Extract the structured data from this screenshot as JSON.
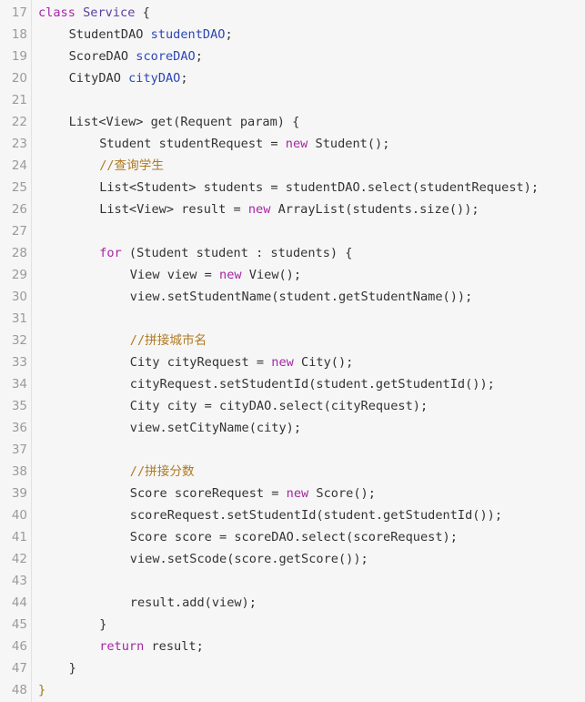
{
  "editor": {
    "language": "java",
    "lines": [
      {
        "n": "17",
        "indent": 0,
        "tokens": [
          {
            "t": "class",
            "k": "kw"
          },
          {
            "t": " ",
            "k": "plain"
          },
          {
            "t": "Service",
            "k": "cls"
          },
          {
            "t": " {",
            "k": "plain"
          }
        ]
      },
      {
        "n": "18",
        "indent": 1,
        "tokens": [
          {
            "t": "StudentDAO ",
            "k": "plain"
          },
          {
            "t": "studentDAO",
            "k": "field"
          },
          {
            "t": ";",
            "k": "plain"
          }
        ]
      },
      {
        "n": "19",
        "indent": 1,
        "tokens": [
          {
            "t": "ScoreDAO ",
            "k": "plain"
          },
          {
            "t": "scoreDAO",
            "k": "field"
          },
          {
            "t": ";",
            "k": "plain"
          }
        ]
      },
      {
        "n": "20",
        "indent": 1,
        "tokens": [
          {
            "t": "CityDAO ",
            "k": "plain"
          },
          {
            "t": "cityDAO",
            "k": "field"
          },
          {
            "t": ";",
            "k": "plain"
          }
        ]
      },
      {
        "n": "21",
        "indent": 0,
        "tokens": []
      },
      {
        "n": "22",
        "indent": 1,
        "tokens": [
          {
            "t": "List<View> get(Requent param) {",
            "k": "plain"
          }
        ]
      },
      {
        "n": "23",
        "indent": 2,
        "tokens": [
          {
            "t": "Student studentRequest = ",
            "k": "plain"
          },
          {
            "t": "new",
            "k": "kw"
          },
          {
            "t": " Student();",
            "k": "plain"
          }
        ]
      },
      {
        "n": "24",
        "indent": 2,
        "tokens": [
          {
            "t": "//查询学生",
            "k": "comment"
          }
        ]
      },
      {
        "n": "25",
        "indent": 2,
        "tokens": [
          {
            "t": "List<Student> students = studentDAO.select(studentRequest);",
            "k": "plain"
          }
        ]
      },
      {
        "n": "26",
        "indent": 2,
        "tokens": [
          {
            "t": "List<View> result = ",
            "k": "plain"
          },
          {
            "t": "new",
            "k": "kw"
          },
          {
            "t": " ArrayList(students.size());",
            "k": "plain"
          }
        ]
      },
      {
        "n": "27",
        "indent": 0,
        "tokens": []
      },
      {
        "n": "28",
        "indent": 2,
        "tokens": [
          {
            "t": "for",
            "k": "kw"
          },
          {
            "t": " (Student student : students) {",
            "k": "plain"
          }
        ]
      },
      {
        "n": "29",
        "indent": 3,
        "tokens": [
          {
            "t": "View view = ",
            "k": "plain"
          },
          {
            "t": "new",
            "k": "kw"
          },
          {
            "t": " View();",
            "k": "plain"
          }
        ]
      },
      {
        "n": "30",
        "indent": 3,
        "tokens": [
          {
            "t": "view.setStudentName(student.getStudentName());",
            "k": "plain"
          }
        ]
      },
      {
        "n": "31",
        "indent": 0,
        "tokens": []
      },
      {
        "n": "32",
        "indent": 3,
        "tokens": [
          {
            "t": "//拼接城市名",
            "k": "comment"
          }
        ]
      },
      {
        "n": "33",
        "indent": 3,
        "tokens": [
          {
            "t": "City cityRequest = ",
            "k": "plain"
          },
          {
            "t": "new",
            "k": "kw"
          },
          {
            "t": " City();",
            "k": "plain"
          }
        ]
      },
      {
        "n": "34",
        "indent": 3,
        "tokens": [
          {
            "t": "cityRequest.setStudentId(student.getStudentId());",
            "k": "plain"
          }
        ]
      },
      {
        "n": "35",
        "indent": 3,
        "tokens": [
          {
            "t": "City city = cityDAO.select(cityRequest);",
            "k": "plain"
          }
        ]
      },
      {
        "n": "36",
        "indent": 3,
        "tokens": [
          {
            "t": "view.setCityName(city);",
            "k": "plain"
          }
        ]
      },
      {
        "n": "37",
        "indent": 0,
        "tokens": []
      },
      {
        "n": "38",
        "indent": 3,
        "tokens": [
          {
            "t": "//拼接分数",
            "k": "comment"
          }
        ]
      },
      {
        "n": "39",
        "indent": 3,
        "tokens": [
          {
            "t": "Score scoreRequest = ",
            "k": "plain"
          },
          {
            "t": "new",
            "k": "kw"
          },
          {
            "t": " Score();",
            "k": "plain"
          }
        ]
      },
      {
        "n": "40",
        "indent": 3,
        "tokens": [
          {
            "t": "scoreRequest.setStudentId(student.getStudentId());",
            "k": "plain"
          }
        ]
      },
      {
        "n": "41",
        "indent": 3,
        "tokens": [
          {
            "t": "Score score = scoreDAO.select(scoreRequest);",
            "k": "plain"
          }
        ]
      },
      {
        "n": "42",
        "indent": 3,
        "tokens": [
          {
            "t": "view.setScode(score.getScore());",
            "k": "plain"
          }
        ]
      },
      {
        "n": "43",
        "indent": 0,
        "tokens": []
      },
      {
        "n": "44",
        "indent": 3,
        "tokens": [
          {
            "t": "result.add(view);",
            "k": "plain"
          }
        ]
      },
      {
        "n": "45",
        "indent": 2,
        "tokens": [
          {
            "t": "}",
            "k": "plain"
          }
        ]
      },
      {
        "n": "46",
        "indent": 2,
        "tokens": [
          {
            "t": "return",
            "k": "kw"
          },
          {
            "t": " result;",
            "k": "plain"
          }
        ]
      },
      {
        "n": "47",
        "indent": 1,
        "tokens": [
          {
            "t": "}",
            "k": "plain"
          }
        ]
      },
      {
        "n": "48",
        "indent": 0,
        "tokens": [
          {
            "t": "}",
            "k": "brace-y"
          }
        ]
      }
    ]
  },
  "colors": {
    "background": "#f6f6f6",
    "line_number": "#9a9a9a",
    "keyword": "#a626a4",
    "class_name": "#5a3fa0",
    "field": "#2c46b8",
    "comment": "#b07a22",
    "text": "#333333"
  }
}
